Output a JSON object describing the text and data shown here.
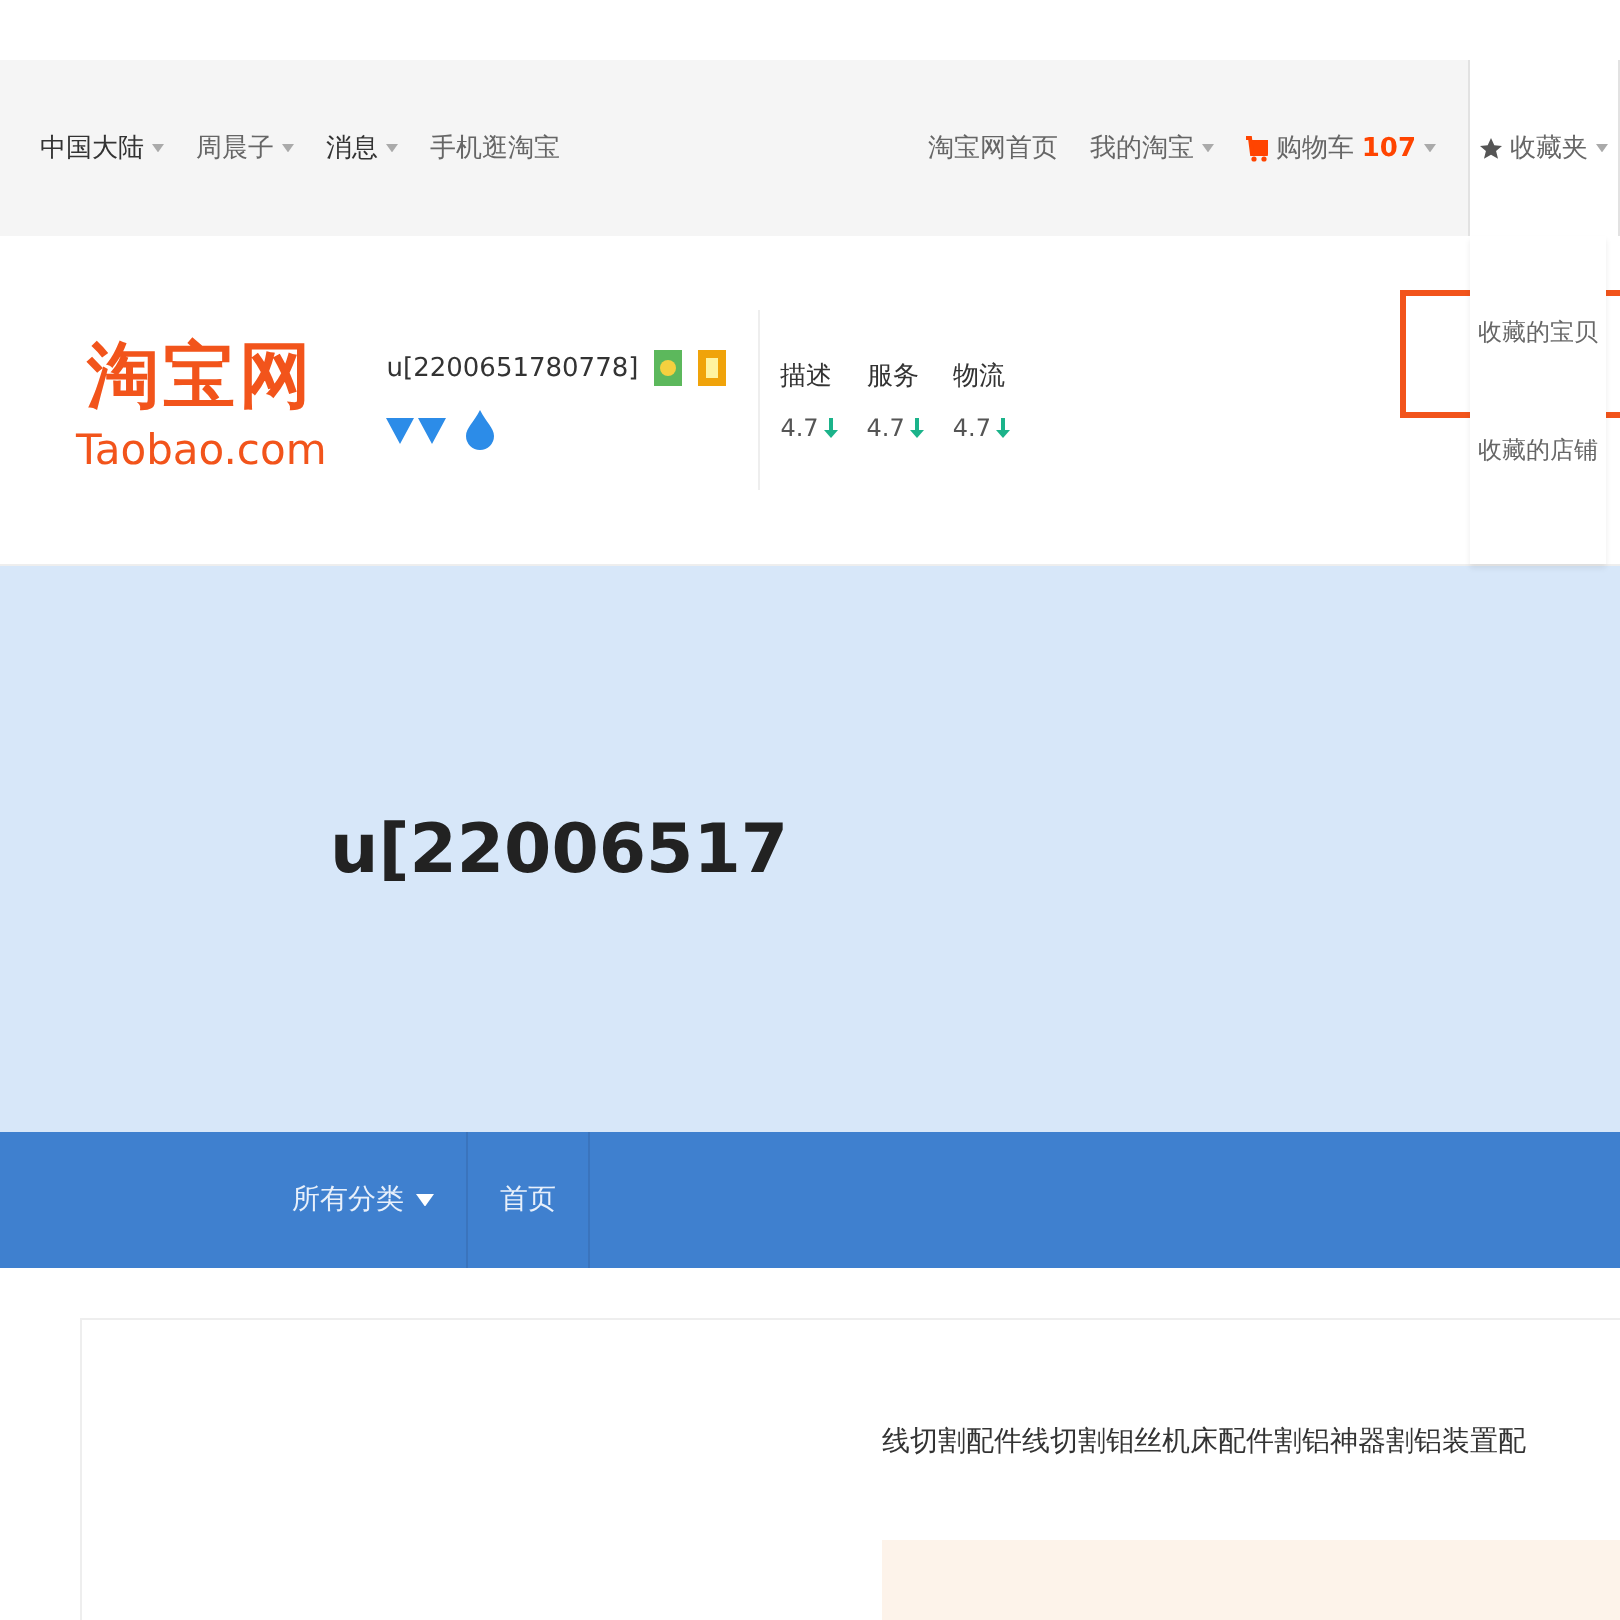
{
  "top_bar": {
    "left": [
      {
        "label": "中国大陆",
        "caret": true,
        "dark": true
      },
      {
        "label": "周晨子",
        "caret": true,
        "dark": false
      },
      {
        "label": "消息",
        "caret": true,
        "dark": true
      },
      {
        "label": "手机逛淘宝",
        "caret": false,
        "dark": false
      }
    ],
    "right": [
      {
        "kind": "link",
        "label": "淘宝网首页",
        "caret": false
      },
      {
        "kind": "link",
        "label": "我的淘宝",
        "caret": true
      },
      {
        "kind": "cart",
        "label": "购物车",
        "count": "107",
        "caret": true
      },
      {
        "kind": "favorites",
        "label": "收藏夹",
        "caret": true,
        "expanded": true,
        "menu": [
          "收藏的宝贝",
          "收藏的店铺"
        ]
      }
    ]
  },
  "logo": {
    "title": "淘宝网",
    "subtitle": "Taobao.com"
  },
  "shop": {
    "name": "u[2200651780778]",
    "ratings": [
      {
        "label": "描述",
        "score": "4.7"
      },
      {
        "label": "服务",
        "score": "4.7"
      },
      {
        "label": "物流",
        "score": "4.7"
      }
    ]
  },
  "banner": {
    "title": "u[22006517"
  },
  "nav": [
    {
      "label": "所有分类",
      "caret": true
    },
    {
      "label": "首页",
      "caret": false
    }
  ],
  "product": {
    "title": "线切割配件线切割钼丝机床配件割铝神器割铝装置配"
  }
}
